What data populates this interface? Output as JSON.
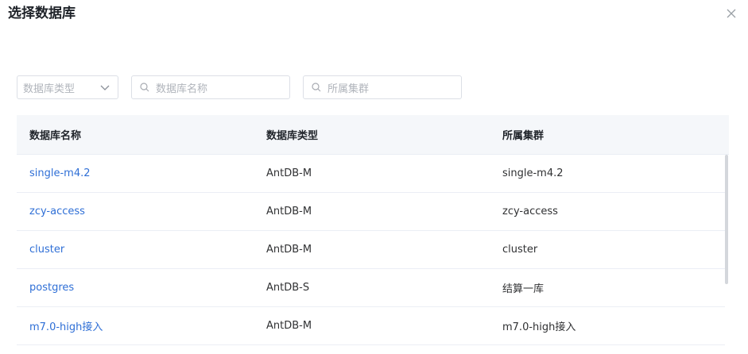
{
  "dialog": {
    "title": "选择数据库"
  },
  "filters": {
    "type_placeholder": "数据库类型",
    "name_placeholder": "数据库名称",
    "cluster_placeholder": "所属集群"
  },
  "table": {
    "columns": [
      "数据库名称",
      "数据库类型",
      "所属集群"
    ],
    "rows": [
      {
        "name": "single-m4.2",
        "type": "AntDB-M",
        "cluster": "single-m4.2"
      },
      {
        "name": "zcy-access",
        "type": "AntDB-M",
        "cluster": "zcy-access"
      },
      {
        "name": "cluster",
        "type": "AntDB-M",
        "cluster": "cluster"
      },
      {
        "name": "postgres",
        "type": "AntDB-S",
        "cluster": "结算一库"
      },
      {
        "name": "m7.0-high接入",
        "type": "AntDB-M",
        "cluster": "m7.0-high接入"
      }
    ]
  },
  "colors": {
    "link": "#2f6fd6",
    "header_bg": "#f5f7fa",
    "border": "#dcdfe6"
  },
  "icons": {
    "close": "close-icon",
    "search": "search-icon",
    "dropdown": "chevron-down-icon"
  }
}
